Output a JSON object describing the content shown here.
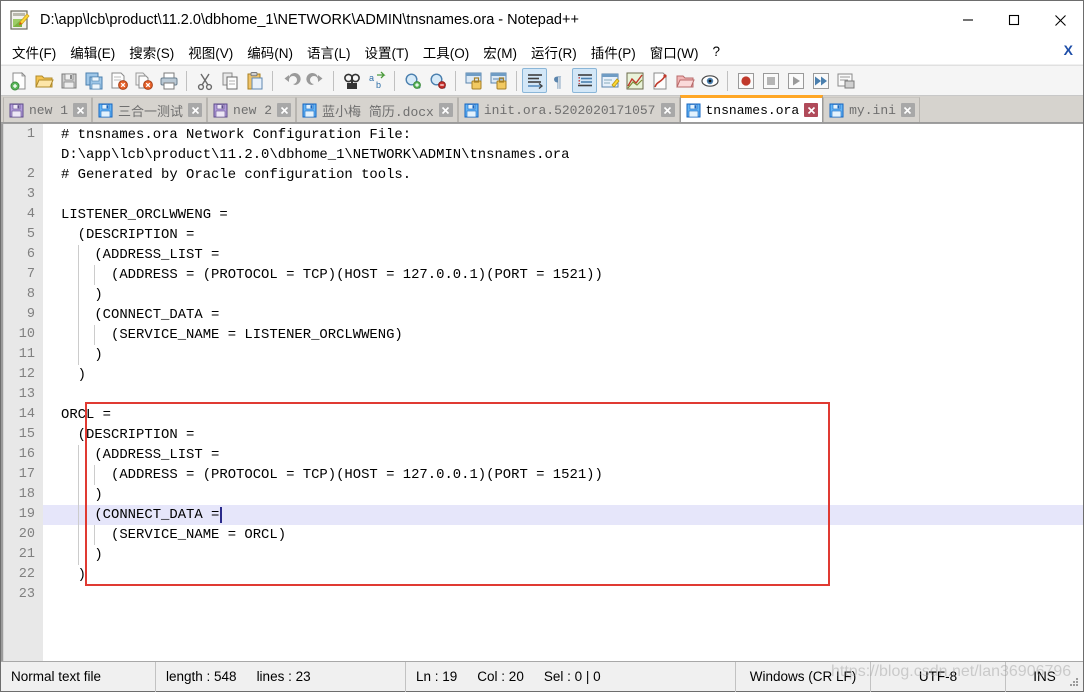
{
  "window": {
    "title": "D:\\app\\lcb\\product\\11.2.0\\dbhome_1\\NETWORK\\ADMIN\\tnsnames.ora - Notepad++",
    "app_icon": "notepad-plus-plus-icon",
    "controls": {
      "minimize": "minimize-icon",
      "maximize": "maximize-icon",
      "close": "close-icon"
    }
  },
  "menubar": {
    "items": [
      {
        "label": "文件(F)"
      },
      {
        "label": "编辑(E)"
      },
      {
        "label": "搜索(S)"
      },
      {
        "label": "视图(V)"
      },
      {
        "label": "编码(N)"
      },
      {
        "label": "语言(L)"
      },
      {
        "label": "设置(T)"
      },
      {
        "label": "工具(O)"
      },
      {
        "label": "宏(M)"
      },
      {
        "label": "运行(R)"
      },
      {
        "label": "插件(P)"
      },
      {
        "label": "窗口(W)"
      },
      {
        "label": "?"
      }
    ],
    "close_document": "X"
  },
  "toolbar": {
    "buttons": [
      {
        "name": "new-file-icon",
        "kind": "icon"
      },
      {
        "name": "open-file-icon",
        "kind": "icon"
      },
      {
        "name": "save-icon",
        "kind": "icon"
      },
      {
        "name": "save-all-icon",
        "kind": "icon"
      },
      {
        "name": "close-file-icon",
        "kind": "icon"
      },
      {
        "name": "close-all-files-icon",
        "kind": "icon"
      },
      {
        "name": "print-icon",
        "kind": "icon"
      },
      {
        "name": "separator",
        "kind": "sep"
      },
      {
        "name": "cut-icon",
        "kind": "icon"
      },
      {
        "name": "copy-icon",
        "kind": "icon"
      },
      {
        "name": "paste-icon",
        "kind": "icon"
      },
      {
        "name": "separator",
        "kind": "sep"
      },
      {
        "name": "undo-icon",
        "kind": "icon"
      },
      {
        "name": "redo-icon",
        "kind": "icon"
      },
      {
        "name": "separator",
        "kind": "sep"
      },
      {
        "name": "find-icon",
        "kind": "icon"
      },
      {
        "name": "replace-icon",
        "kind": "icon"
      },
      {
        "name": "separator",
        "kind": "sep"
      },
      {
        "name": "zoom-in-icon",
        "kind": "icon"
      },
      {
        "name": "zoom-out-icon",
        "kind": "icon"
      },
      {
        "name": "separator",
        "kind": "sep"
      },
      {
        "name": "sync-vertical-scroll-icon",
        "kind": "icon"
      },
      {
        "name": "sync-horizontal-scroll-icon",
        "kind": "icon"
      },
      {
        "name": "separator",
        "kind": "sep"
      },
      {
        "name": "word-wrap-icon",
        "kind": "icon",
        "pressed": true
      },
      {
        "name": "show-all-characters-icon",
        "kind": "icon"
      },
      {
        "name": "show-indent-guide-icon",
        "kind": "icon",
        "pressed": true
      },
      {
        "name": "user-defined-dialog-icon",
        "kind": "icon"
      },
      {
        "name": "document-map-icon",
        "kind": "icon"
      },
      {
        "name": "function-list-icon",
        "kind": "icon"
      },
      {
        "name": "folder-as-workspace-icon",
        "kind": "icon"
      },
      {
        "name": "monitoring-icon",
        "kind": "icon"
      },
      {
        "name": "separator",
        "kind": "sep"
      },
      {
        "name": "record-macro-icon",
        "kind": "icon"
      },
      {
        "name": "stop-recording-icon",
        "kind": "icon"
      },
      {
        "name": "play-macro-icon",
        "kind": "icon"
      },
      {
        "name": "run-macro-multiple-icon",
        "kind": "icon"
      },
      {
        "name": "run-icon",
        "kind": "icon"
      }
    ]
  },
  "tabs": [
    {
      "label": "new 1",
      "icon": "save-icon-purple",
      "active": false
    },
    {
      "label": "三合一测试",
      "icon": "save-icon-blue",
      "active": false
    },
    {
      "label": "new 2",
      "icon": "save-icon-purple",
      "active": false
    },
    {
      "label": "蓝小梅 简历.docx",
      "icon": "save-icon-blue",
      "active": false
    },
    {
      "label": "init.ora.5202020171057",
      "icon": "save-icon-blue",
      "active": false
    },
    {
      "label": "tnsnames.ora",
      "icon": "save-icon-blue",
      "active": true
    },
    {
      "label": "my.ini",
      "icon": "save-icon-blue",
      "active": false
    }
  ],
  "editor": {
    "lines": [
      {
        "num": 1,
        "text": "# tnsnames.ora Network Configuration File:"
      },
      {
        "num": null,
        "text": "D:\\app\\lcb\\product\\11.2.0\\dbhome_1\\NETWORK\\ADMIN\\tnsnames.ora",
        "wrapped": true
      },
      {
        "num": 2,
        "text": "# Generated by Oracle configuration tools."
      },
      {
        "num": 3,
        "text": ""
      },
      {
        "num": 4,
        "text": "LISTENER_ORCLWWENG ="
      },
      {
        "num": 5,
        "text": "  (DESCRIPTION ="
      },
      {
        "num": 6,
        "text": "    (ADDRESS_LIST ="
      },
      {
        "num": 7,
        "text": "      (ADDRESS = (PROTOCOL = TCP)(HOST = 127.0.0.1)(PORT = 1521))"
      },
      {
        "num": 8,
        "text": "    )"
      },
      {
        "num": 9,
        "text": "    (CONNECT_DATA ="
      },
      {
        "num": 10,
        "text": "      (SERVICE_NAME = LISTENER_ORCLWWENG)"
      },
      {
        "num": 11,
        "text": "    )"
      },
      {
        "num": 12,
        "text": "  )"
      },
      {
        "num": 13,
        "text": ""
      },
      {
        "num": 14,
        "text": "ORCL ="
      },
      {
        "num": 15,
        "text": "  (DESCRIPTION ="
      },
      {
        "num": 16,
        "text": "    (ADDRESS_LIST ="
      },
      {
        "num": 17,
        "text": "      (ADDRESS = (PROTOCOL = TCP)(HOST = 127.0.0.1)(PORT = 1521))"
      },
      {
        "num": 18,
        "text": "    )"
      },
      {
        "num": 19,
        "text": "    (CONNECT_DATA =",
        "current": true
      },
      {
        "num": 20,
        "text": "      (SERVICE_NAME = ORCL)"
      },
      {
        "num": 21,
        "text": "    )"
      },
      {
        "num": 22,
        "text": "  )"
      },
      {
        "num": 23,
        "text": ""
      }
    ],
    "annotation_box_color": "#e03a32",
    "current_line_color": "#e6e6fa"
  },
  "watermark": {
    "text": "https://blog.csdn.net/lan36906796"
  },
  "statusbar": {
    "file_type": "Normal text file",
    "length_label": "length : 548",
    "lines_label": "lines : 23",
    "ln": "Ln : 19",
    "col": "Col : 20",
    "sel": "Sel : 0 | 0",
    "eol": "Windows (CR LF)",
    "encoding": "UTF-8",
    "insert_mode": "INS"
  }
}
